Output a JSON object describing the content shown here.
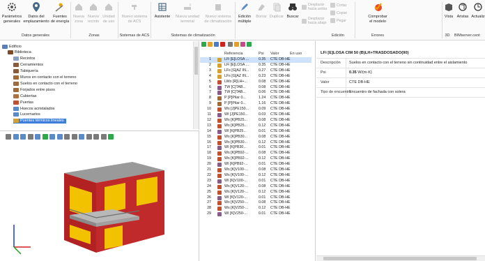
{
  "ribbon": {
    "buttons": [
      {
        "key": "parametros",
        "label": "Parámetros\ngenerales",
        "icon": "gear-icon",
        "enabled": true
      },
      {
        "key": "datos",
        "label": "Datos del\nemplazamiento",
        "icon": "location-pin-icon",
        "enabled": true
      },
      {
        "key": "fuentes",
        "label": "Fuentes\nde energía",
        "icon": "sun-icon",
        "enabled": true
      },
      {
        "key": "nueva_zona",
        "label": "Nueva\nzona",
        "icon": "house-icon",
        "enabled": false
      },
      {
        "key": "nuevo_recinto",
        "label": "Nuevo\nrecinto",
        "icon": "house-icon",
        "enabled": false
      },
      {
        "key": "unidad_uso",
        "label": "Unidad\nde uso",
        "icon": "house-icon",
        "enabled": false
      },
      {
        "key": "nuevo_sistema_acs",
        "label": "Nuevo sistema\nde ACS",
        "icon": "tap-icon",
        "enabled": false
      },
      {
        "key": "asistente",
        "label": "Asistente",
        "icon": "grid-icon",
        "enabled": true
      },
      {
        "key": "nueva_unidad",
        "label": "Nueva unidad\nterminal",
        "icon": "terminal-unit-icon",
        "enabled": false
      },
      {
        "key": "nuevo_sistema_clim",
        "label": "Nuevo sistema\nde climatización",
        "icon": "climate-icon",
        "enabled": false
      },
      {
        "key": "edicion_multiple",
        "label": "Edición\nmúltiple",
        "icon": "edit-icon",
        "enabled": true
      },
      {
        "key": "borrar",
        "label": "Borrar",
        "icon": "eraser-icon",
        "enabled": false
      },
      {
        "key": "duplicar",
        "label": "Duplicar",
        "icon": "duplicate-icon",
        "enabled": false
      },
      {
        "key": "buscar",
        "label": "Buscar",
        "icon": "binoculars-icon",
        "enabled": true
      },
      {
        "key": "comprobar",
        "label": "Comprobar\nel modelo",
        "icon": "check-model-icon",
        "enabled": true
      },
      {
        "key": "vista",
        "label": "Vista",
        "icon": "view-icon",
        "enabled": true
      },
      {
        "key": "aristas",
        "label": "Aristas",
        "icon": "edges-icon",
        "enabled": true
      },
      {
        "key": "actualizar",
        "label": "Actualiz",
        "icon": "refresh-icon",
        "enabled": true
      }
    ],
    "small": {
      "desplazar_arriba": "Desplazar\nhacia arriba",
      "desplazar_abajo": "Desplazar\nhacia abajo",
      "cortar": "Cortar",
      "copiar": "Copiar",
      "pegar": "Pegar"
    },
    "groups": {
      "datos_generales": "Datos generales",
      "zonas": "Zonas",
      "sistemas_acs": "Sistemas de ACS",
      "sistemas_clim": "Sistemas de climatización",
      "edicion": "Edición",
      "errores": "Errores",
      "g3d": "3D",
      "bimserver": "BIMserver.cent"
    }
  },
  "tree": {
    "items": [
      {
        "label": "Edificio",
        "level": 0,
        "color": "#5a7fb8"
      },
      {
        "label": "Biblioteca",
        "level": 1,
        "color": "#7a4a2a"
      },
      {
        "label": "Recintos",
        "level": 2,
        "color": "#8aa0c0"
      },
      {
        "label": "Cerramientos",
        "level": 2,
        "color": "#8a5a3a"
      },
      {
        "label": "Tabiquería",
        "level": 2,
        "color": "#8a5a3a"
      },
      {
        "label": "Muros en contacto con el terreno",
        "level": 2,
        "color": "#a06a3a"
      },
      {
        "label": "Suelos en contacto con el terreno",
        "level": 2,
        "color": "#a06a3a"
      },
      {
        "label": "Forjados entre pisos",
        "level": 2,
        "color": "#a06a3a"
      },
      {
        "label": "Cubiertas",
        "level": 2,
        "color": "#b07040"
      },
      {
        "label": "Puertas",
        "level": 2,
        "color": "#c05030"
      },
      {
        "label": "Huecos acristalados",
        "level": 2,
        "color": "#5a8ac8"
      },
      {
        "label": "Lucernarios",
        "level": 2,
        "color": "#5a8ac8"
      },
      {
        "label": "Puentes térmicos lineales",
        "level": 2,
        "color": "#d4a030",
        "selected": true
      }
    ]
  },
  "table": {
    "headers": {
      "ref": "Referencia",
      "psi": "Psi",
      "valor": "Valor",
      "en_uso": "En uso"
    },
    "rows": [
      {
        "n": "1",
        "ref": "LFi [E]LOSA ...",
        "psi": "0.35",
        "valor": "CTE DB-HE",
        "color": "#d4a030",
        "selected": true
      },
      {
        "n": "2",
        "ref": "LFi [E]LOSA ...",
        "psi": "0.35",
        "valor": "CTE DB-HE",
        "color": "#d4a030"
      },
      {
        "n": "3",
        "ref": "LFs [G]AZ IN...",
        "psi": "0.27",
        "valor": "CTE DB-HE",
        "color": "#d4a030"
      },
      {
        "n": "4",
        "ref": "LFs [G]AZ IN...",
        "psi": "0.23",
        "valor": "CTE DB-HE",
        "color": "#d4a030"
      },
      {
        "n": "5",
        "ref": "LWo [R]LH+...",
        "psi": "0.08",
        "valor": "CTE DB-HE",
        "color": "#c05030"
      },
      {
        "n": "6",
        "ref": "TW [C]TAB...",
        "psi": "0.08",
        "valor": "CTE DB-HE",
        "color": "#8a5a8a"
      },
      {
        "n": "7",
        "ref": "TW [C]TAB...",
        "psi": "0.06",
        "valor": "CTE DB-HE",
        "color": "#8a5a8a"
      },
      {
        "n": "8",
        "ref": "P [P]Pilar 0...",
        "psi": "1.24",
        "valor": "CTE DB-HE",
        "color": "#a06a3a"
      },
      {
        "n": "9",
        "ref": "P [P]Pilar 0...",
        "psi": "1.16",
        "valor": "CTE DB-HE",
        "color": "#a06a3a"
      },
      {
        "n": "10",
        "ref": "Ws [J]PE150...",
        "psi": "0.09",
        "valor": "CTE DB-HE",
        "color": "#c05030"
      },
      {
        "n": "11",
        "ref": "WI [J]PE150...",
        "psi": "0.03",
        "valor": "CTE DB-HE",
        "color": "#8a5a8a"
      },
      {
        "n": "12",
        "ref": "Ws [K]PB25...",
        "psi": "0.08",
        "valor": "CTE DB-HE",
        "color": "#c05030"
      },
      {
        "n": "13",
        "ref": "Ws [K]PB25...",
        "psi": "0.12",
        "valor": "CTE DB-HE",
        "color": "#c05030"
      },
      {
        "n": "14",
        "ref": "WI [K]PB25...",
        "psi": "0.01",
        "valor": "CTE DB-HE",
        "color": "#8a5a8a"
      },
      {
        "n": "15",
        "ref": "Ws [K]PB30...",
        "psi": "0.08",
        "valor": "CTE DB-HE",
        "color": "#c05030"
      },
      {
        "n": "16",
        "ref": "Ws [K]PB30...",
        "psi": "0.12",
        "valor": "CTE DB-HE",
        "color": "#c05030"
      },
      {
        "n": "17",
        "ref": "WI [K]PB30...",
        "psi": "0.01",
        "valor": "CTE DB-HE",
        "color": "#8a5a8a"
      },
      {
        "n": "18",
        "ref": "Ws [K]PB92-...",
        "psi": "0.08",
        "valor": "CTE DB-HE",
        "color": "#c05030"
      },
      {
        "n": "19",
        "ref": "Ws [K]PB92-...",
        "psi": "0.12",
        "valor": "CTE DB-HE",
        "color": "#c05030"
      },
      {
        "n": "20",
        "ref": "WI [K]PB92-...",
        "psi": "0.01",
        "valor": "CTE DB-HE",
        "color": "#8a5a8a"
      },
      {
        "n": "21",
        "ref": "Ws [K]V100-...",
        "psi": "0.08",
        "valor": "CTE DB-HE",
        "color": "#c05030"
      },
      {
        "n": "22",
        "ref": "Ws [K]V100-...",
        "psi": "0.12",
        "valor": "CTE DB-HE",
        "color": "#c05030"
      },
      {
        "n": "23",
        "ref": "WI [K]V100-...",
        "psi": "0.01",
        "valor": "CTE DB-HE",
        "color": "#8a5a8a"
      },
      {
        "n": "24",
        "ref": "Ws [K]V120-...",
        "psi": "0.08",
        "valor": "CTE DB-HE",
        "color": "#c05030"
      },
      {
        "n": "25",
        "ref": "Ws [K]V120-...",
        "psi": "0.12",
        "valor": "CTE DB-HE",
        "color": "#c05030"
      },
      {
        "n": "26",
        "ref": "WI [K]V120-...",
        "psi": "0.01",
        "valor": "CTE DB-HE",
        "color": "#8a5a8a"
      },
      {
        "n": "27",
        "ref": "Ws [K]V250-...",
        "psi": "0.08",
        "valor": "CTE DB-HE",
        "color": "#c05030"
      },
      {
        "n": "28",
        "ref": "Ws [K]V250-...",
        "psi": "0.12",
        "valor": "CTE DB-HE",
        "color": "#c05030"
      },
      {
        "n": "29",
        "ref": "WI [K]V250-...",
        "psi": "0.01",
        "valor": "CTE DB-HE",
        "color": "#8a5a8a"
      }
    ]
  },
  "detail": {
    "title": "LFi [E]LOSA CIM 50 (B)LH+TRASDOSADO(90)",
    "props": [
      {
        "key": "Descripción",
        "value": "Suelos en contacto con el terreno sin continuidad entre el aislamiento"
      },
      {
        "key": "Psi",
        "value": "0.35",
        "unit": " W/(m·K)"
      },
      {
        "key": "Valor",
        "value": "CTE DB-HE"
      },
      {
        "key": "Tipo de encuentro",
        "value": "Encuentro de fachada con solera"
      }
    ]
  },
  "colors": {
    "selection": "#3d7fd9",
    "row_selection": "#cfe2fb",
    "facade_red": "#b22222",
    "facade_yellow": "#f2c200",
    "roof_gray": "#9a9a9a"
  }
}
